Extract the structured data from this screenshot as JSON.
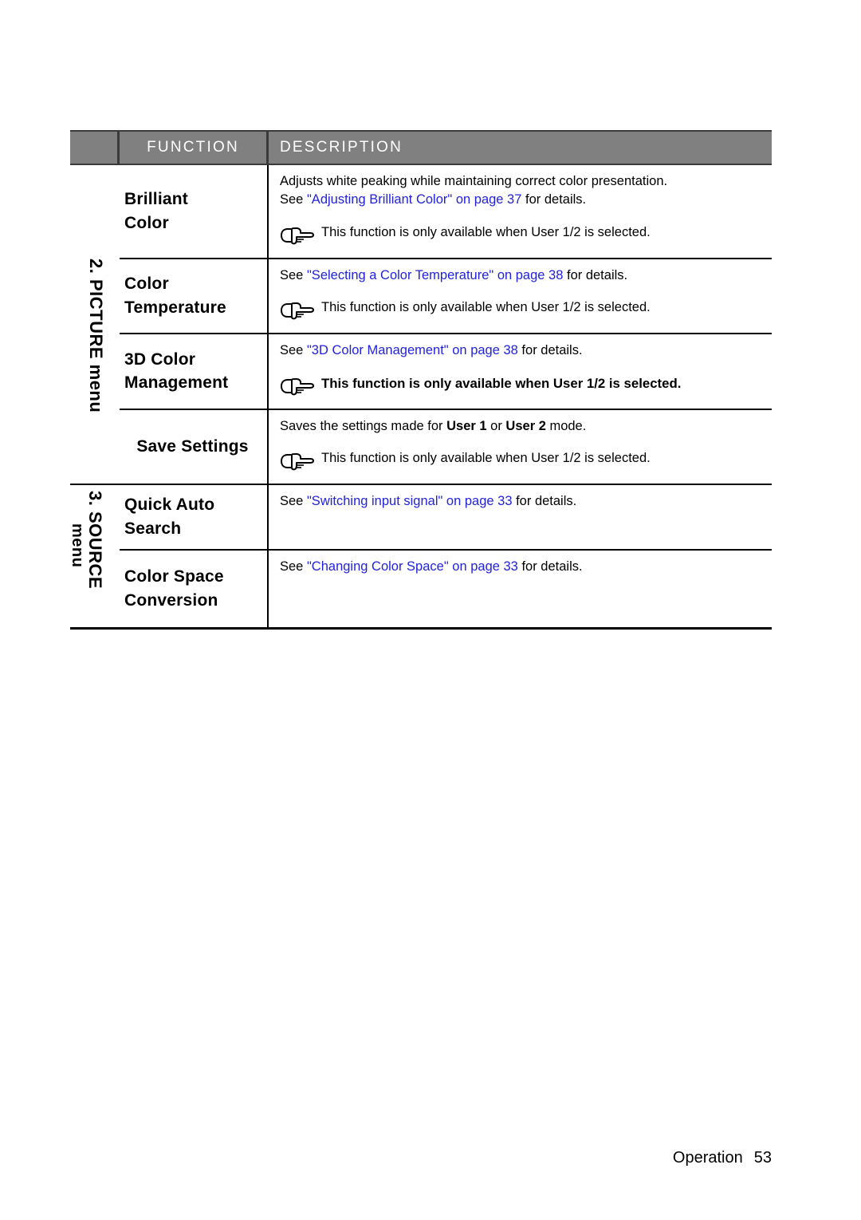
{
  "table": {
    "headers": {
      "function": "FUNCTION",
      "description": "DESCRIPTION"
    },
    "groups": [
      {
        "label": "2. PICTURE menu",
        "rows": [
          {
            "function": [
              "Brilliant",
              "Color"
            ],
            "lead_plain_1": "Adjusts white peaking while maintaining correct color presentation.",
            "lead_see": "See ",
            "lead_link": "\"Adjusting Brilliant Color\" on page 37",
            "lead_tail": " for details.",
            "note": "This function is only available when User 1/2 is selected.",
            "note_bold": false,
            "icon": "pointing-hand-icon"
          },
          {
            "function": [
              "Color",
              "Temperature"
            ],
            "lead_see": "See ",
            "lead_link": "\"Selecting a Color Temperature\" on page 38",
            "lead_tail": " for details.",
            "note": "This function is only available when User 1/2 is selected.",
            "note_bold": false,
            "icon": "pointing-hand-icon"
          },
          {
            "function": [
              "3D Color",
              "Management"
            ],
            "lead_see": "See ",
            "lead_link": "\"3D Color Management\" on page 38",
            "lead_tail": " for details.",
            "note": "This function is only available when User 1/2 is selected.",
            "note_bold": true,
            "icon": "pointing-hand-icon"
          },
          {
            "function": [
              "Save Settings"
            ],
            "lead_pre": "Saves the settings made for ",
            "lead_b1": "User 1",
            "lead_mid": " or ",
            "lead_b2": "User 2",
            "lead_post": " mode.",
            "note": "This function is only available when User 1/2 is selected.",
            "note_bold": false,
            "icon": "pointing-hand-icon"
          }
        ]
      },
      {
        "label_main": "3. SOURCE",
        "label_sub": "menu",
        "rows": [
          {
            "function": [
              "Quick Auto",
              "Search"
            ],
            "lead_see": "See ",
            "lead_link": "\"Switching input signal\" on page 33",
            "lead_tail": " for details."
          },
          {
            "function": [
              "Color Space",
              "Conversion"
            ],
            "lead_see": "See ",
            "lead_link": "\"Changing Color Space\" on page 33",
            "lead_tail": " for details."
          }
        ]
      }
    ]
  },
  "footer": {
    "section": "Operation",
    "page": "53"
  },
  "colors": {
    "header_bg": "#808080",
    "header_text": "#ffffff",
    "link": "#2222dd",
    "rule": "#000000"
  }
}
